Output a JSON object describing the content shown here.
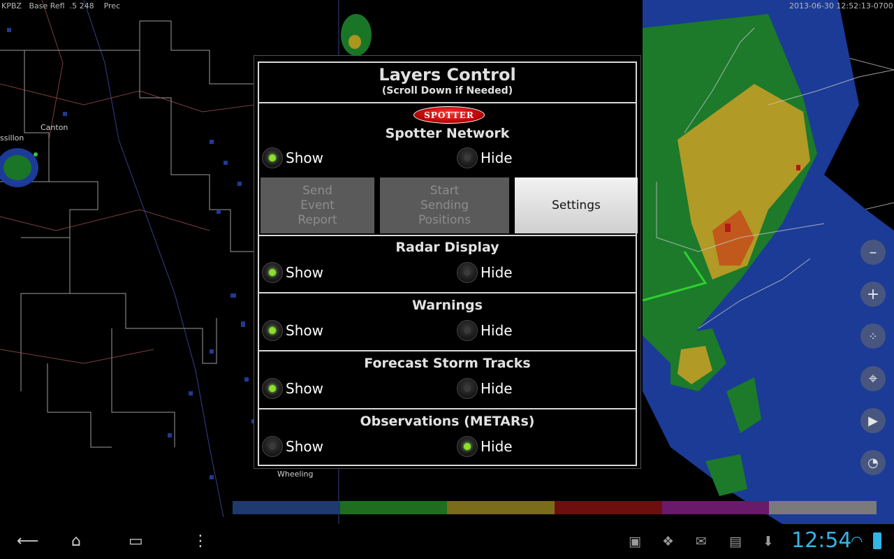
{
  "status_top": {
    "station": "KPBZ",
    "product": "Base Refl",
    "tilt": ".5",
    "value": "248",
    "mode": "Prec",
    "timestamp": "2013-06-30 12:52:13-0700"
  },
  "cities": [
    "Canton",
    "ssillon",
    "Wheeling"
  ],
  "dialog": {
    "title": "Layers Control",
    "subtitle": "(Scroll Down if Needed)",
    "logo_text": "SPOTTER",
    "sections": [
      {
        "title": "Spotter Network",
        "show_label": "Show",
        "hide_label": "Hide",
        "selected": "show"
      },
      {
        "title": "Radar Display",
        "show_label": "Show",
        "hide_label": "Hide",
        "selected": "show"
      },
      {
        "title": "Warnings",
        "show_label": "Show",
        "hide_label": "Hide",
        "selected": "show"
      },
      {
        "title": "Forecast Storm Tracks",
        "show_label": "Show",
        "hide_label": "Hide",
        "selected": "show"
      },
      {
        "title": "Observations (METARs)",
        "show_label": "Show",
        "hide_label": "Hide",
        "selected": "hide"
      }
    ],
    "buttons": {
      "send_event": "Send\nEvent\nReport",
      "start_sending": "Start\nSending\nPositions",
      "settings": "Settings"
    }
  },
  "tools": [
    "zoom-out-icon",
    "zoom-in-icon",
    "layers-icon",
    "locate-icon",
    "play-icon",
    "compass-icon"
  ],
  "colorbar": [
    "#1e3a6e",
    "#1f7a1f",
    "#8a7a1a",
    "#7a0f0f",
    "#7a1a7a",
    "#8a8a8a"
  ],
  "navbar": {
    "icons": [
      "back-icon",
      "home-icon",
      "recent-apps-icon",
      "menu-icon"
    ],
    "notifications": [
      "gallery-icon",
      "dropbox-icon",
      "gmail-icon",
      "store-icon",
      "download-icon"
    ],
    "clock": "12:54"
  }
}
